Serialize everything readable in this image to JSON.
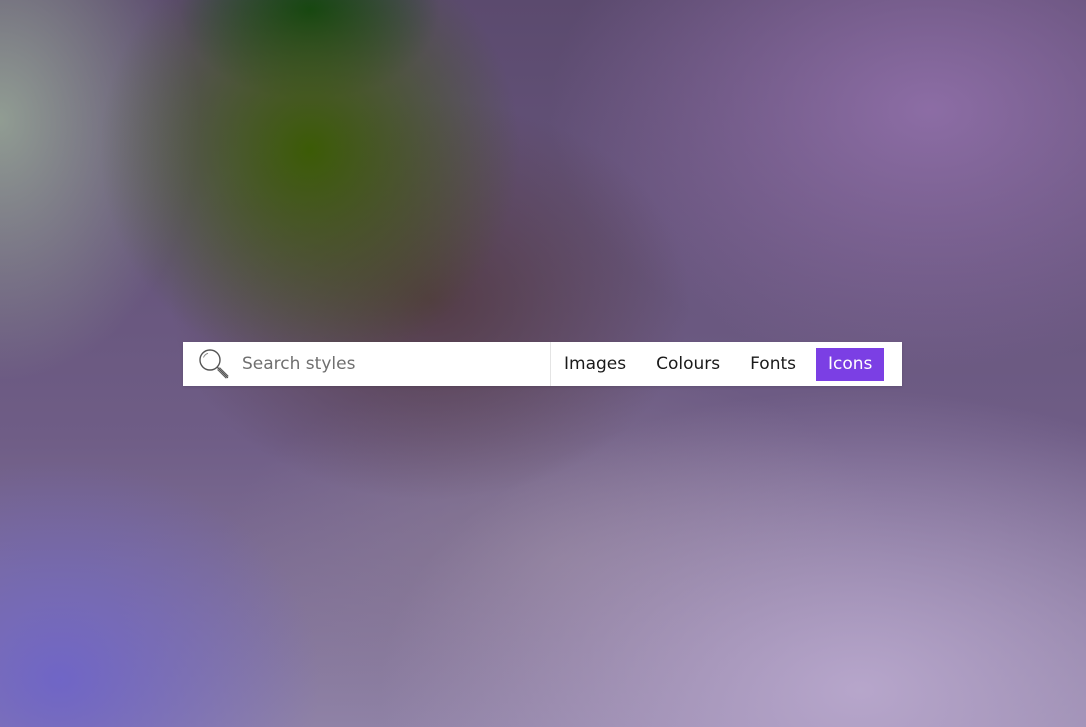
{
  "search": {
    "placeholder": "Search styles",
    "value": "",
    "icon": "search-icon"
  },
  "tabs": [
    {
      "label": "Images",
      "active": false
    },
    {
      "label": "Colours",
      "active": false
    },
    {
      "label": "Fonts",
      "active": false
    },
    {
      "label": "Icons",
      "active": true
    }
  ],
  "colors": {
    "accent": "#7b3fe4",
    "bar_background": "#ffffff",
    "text": "#1a1a1a"
  }
}
